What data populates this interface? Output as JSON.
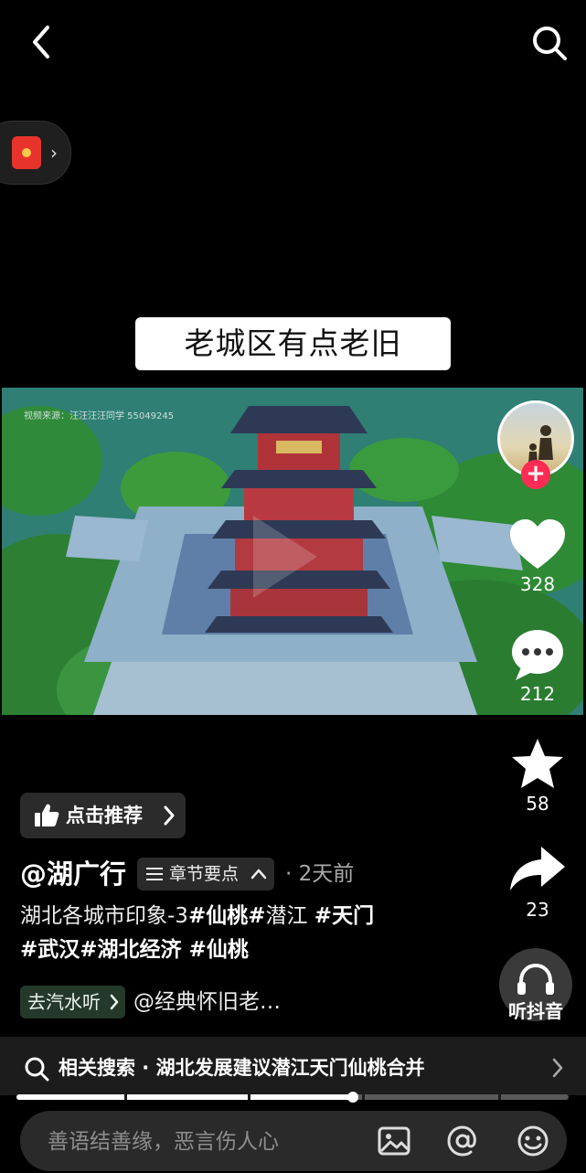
{
  "caption": "老城区有点老旧",
  "video": {
    "watermark": "视频来源：汪汪汪汪同学 55049245"
  },
  "actions": {
    "likes": "328",
    "comments": "212",
    "favorites": "58",
    "shares": "23",
    "listen_label": "听抖音"
  },
  "recommend_label": "点击推荐",
  "author": "@湖广行",
  "chapters_label": "章节要点",
  "time_ago": "· 2天前",
  "description": {
    "plain": "湖北各城市印象-3",
    "tag1": "#仙桃#",
    "mid": "潜江 ",
    "tag2": "#天门",
    "line2": "#武汉#湖北经济 #仙桃"
  },
  "music": {
    "tag": "去汽水听",
    "name": "@经典怀旧老…"
  },
  "related": {
    "text": "相关搜索 · 湖北发展建议潜江天门仙桃合并"
  },
  "progress": {
    "played": 0.61
  },
  "comment": {
    "placeholder": "善语结善缘，恶言伤人心"
  }
}
